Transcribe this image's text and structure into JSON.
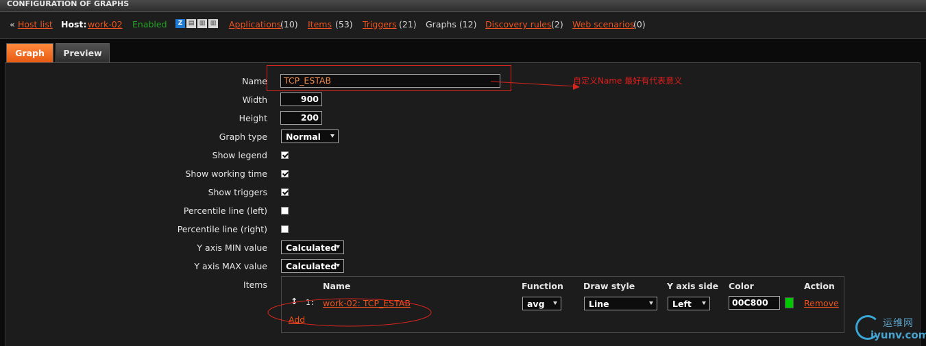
{
  "page_title": "CONFIGURATION OF GRAPHS",
  "host_bar": {
    "back_prefix": "«",
    "host_list": "Host list",
    "host_label": "Host:",
    "host_name": "work-02",
    "status": "Enabled",
    "availability": [
      "Z",
      "SNMP",
      "JMX",
      "IPMI"
    ],
    "applications": "Applications",
    "applications_count": "(10)",
    "items": "Items",
    "items_count": "(53)",
    "triggers": "Triggers",
    "triggers_count": "(21)",
    "graphs": "Graphs (12)",
    "discovery_rules": "Discovery rules",
    "discovery_count": "(2)",
    "web_scenarios": "Web scenarios",
    "web_count": "(0)"
  },
  "tabs": [
    {
      "label": "Graph",
      "active": true
    },
    {
      "label": "Preview",
      "active": false
    }
  ],
  "form": {
    "name_label": "Name",
    "name_value": "TCP_ESTAB",
    "width_label": "Width",
    "width_value": "900",
    "height_label": "Height",
    "height_value": "200",
    "graph_type_label": "Graph type",
    "graph_type_value": "Normal",
    "show_legend_label": "Show legend",
    "show_legend": true,
    "show_working_time_label": "Show working time",
    "show_working_time": true,
    "show_triggers_label": "Show triggers",
    "show_triggers": true,
    "percentile_left_label": "Percentile line (left)",
    "percentile_left": false,
    "percentile_right_label": "Percentile line (right)",
    "percentile_right": false,
    "y_min_label": "Y axis MIN value",
    "y_min_value": "Calculated",
    "y_max_label": "Y axis MAX value",
    "y_max_value": "Calculated",
    "items_label": "Items"
  },
  "items_table": {
    "headers": {
      "name": "Name",
      "function": "Function",
      "draw_style": "Draw style",
      "y_axis_side": "Y axis side",
      "color": "Color",
      "action": "Action"
    },
    "rows": [
      {
        "index": "1:",
        "name": "work-02: TCP_ESTAB",
        "function": "avg",
        "draw_style": "Line",
        "y_axis_side": "Left",
        "color": "00C800",
        "action": "Remove"
      }
    ],
    "add_label": "Add"
  },
  "annotation": {
    "text": "自定义Name 最好有代表意义"
  },
  "colors": {
    "accent": "#f0531c",
    "enabled": "#21a621",
    "annotation": "#d6261f",
    "item_color": "#00C800"
  },
  "watermark": {
    "top": "运维网",
    "bottom": "iyunv.com"
  }
}
